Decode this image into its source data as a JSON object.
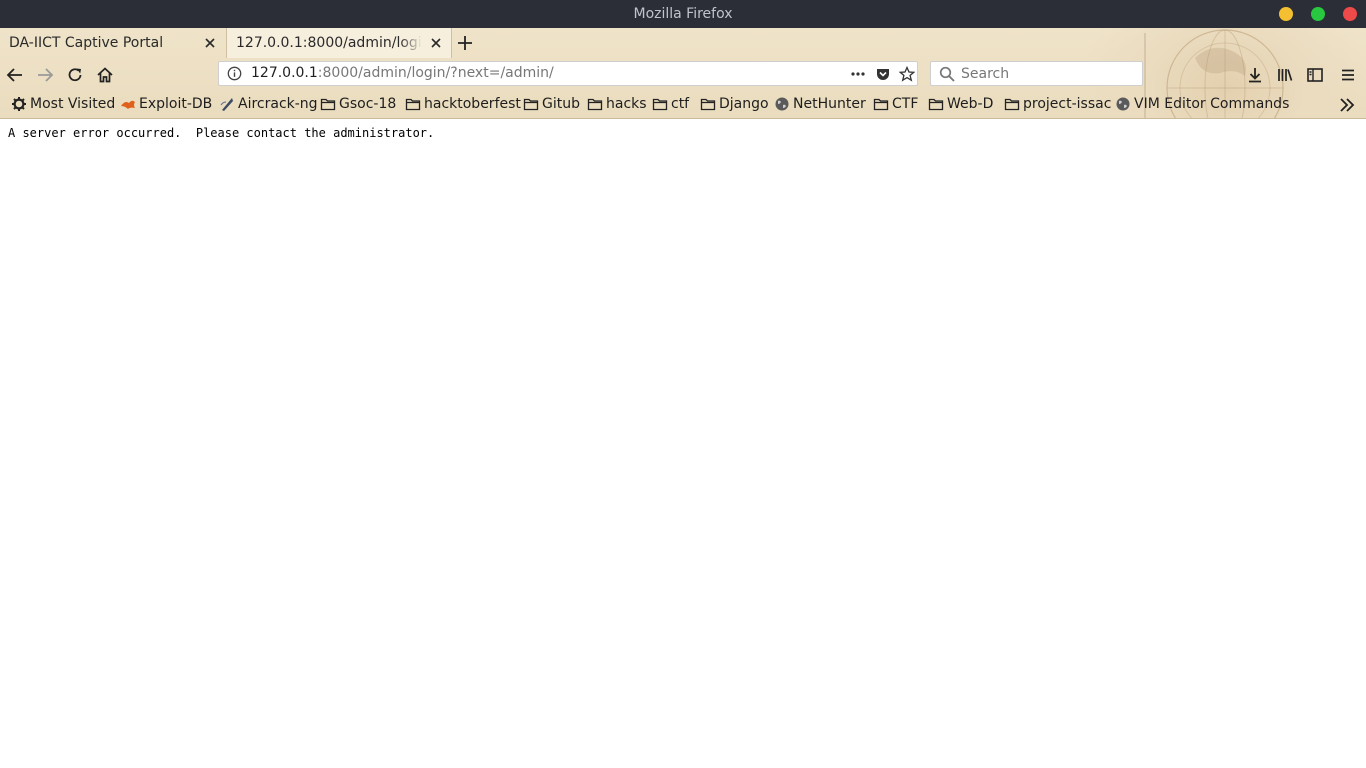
{
  "window": {
    "title": "Mozilla Firefox",
    "controls": {
      "minimize_color": "#f4bf30",
      "maximize_color": "#28c840",
      "close_color": "#ee4a4a"
    }
  },
  "tabs": [
    {
      "label": "DA-IICT Captive Portal",
      "active": false
    },
    {
      "label": "127.0.0.1:8000/admin/login/?next=/admin/",
      "active": true
    }
  ],
  "navbar": {
    "url_host": "127.0.0.1",
    "url_rest": ":8000/admin/login/?next=/admin/",
    "search_placeholder": "Search"
  },
  "bookmarks": [
    {
      "label": "Most Visited",
      "icon": "gear-icon"
    },
    {
      "label": "Exploit-DB",
      "icon": "exploitdb-icon"
    },
    {
      "label": "Aircrack-ng",
      "icon": "aircrack-icon"
    },
    {
      "label": "Gsoc-18",
      "icon": "folder-icon"
    },
    {
      "label": "hacktoberfest",
      "icon": "folder-icon"
    },
    {
      "label": "Gitub",
      "icon": "folder-icon"
    },
    {
      "label": "hacks",
      "icon": "folder-icon"
    },
    {
      "label": "ctf",
      "icon": "folder-icon"
    },
    {
      "label": "Django",
      "icon": "folder-icon"
    },
    {
      "label": "NetHunter",
      "icon": "globe-icon"
    },
    {
      "label": "CTF",
      "icon": "folder-icon"
    },
    {
      "label": "Web-D",
      "icon": "folder-icon"
    },
    {
      "label": "project-issac",
      "icon": "folder-icon"
    },
    {
      "label": "VIM Editor Commands",
      "icon": "globe-icon"
    }
  ],
  "page": {
    "message": "A server error occurred.  Please contact the administrator."
  }
}
